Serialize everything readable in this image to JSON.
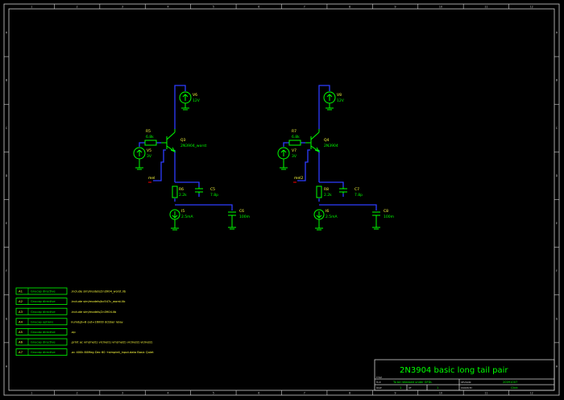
{
  "border": {
    "top_numbers": [
      "1",
      "2",
      "3",
      "4",
      "5",
      "6",
      "7",
      "8",
      "9",
      "10",
      "11",
      "12"
    ],
    "side_letters": [
      "A",
      "B",
      "C",
      "D",
      "E",
      "F",
      "G",
      "H"
    ]
  },
  "circuit_left": {
    "supply": {
      "ref": "V6",
      "value": "12V"
    },
    "bias_resistor": {
      "ref": "R5",
      "value": "6.8k"
    },
    "input_source": {
      "ref": "V5",
      "value": "3V"
    },
    "transistor": {
      "ref": "Q3",
      "value": "2N3904_worst"
    },
    "net_label": "mel",
    "emitter_resistor": {
      "ref": "R6",
      "value": "2.2k"
    },
    "cap_small": {
      "ref": "C5",
      "value": "7.8p"
    },
    "current_source": {
      "ref": "I5",
      "value": "2.5mA"
    },
    "cap_load": {
      "ref": "C6",
      "value": "100m"
    }
  },
  "circuit_right": {
    "supply": {
      "ref": "V8",
      "value": "12V"
    },
    "bias_resistor": {
      "ref": "R7",
      "value": "6.8k"
    },
    "input_source": {
      "ref": "V7",
      "value": "3V"
    },
    "transistor": {
      "ref": "Q4",
      "value": "2N3904"
    },
    "net_label": "mel2",
    "emitter_resistor": {
      "ref": "R8",
      "value": "2.2k"
    },
    "cap_small": {
      "ref": "C7",
      "value": "7.8p"
    },
    "current_source": {
      "ref": "I6",
      "value": "2.5mA"
    },
    "cap_load": {
      "ref": "C8",
      "value": "100m"
    }
  },
  "directives": [
    {
      "id": "A1",
      "type": "Gnucap directive",
      "text": ".include sim/models/2n3904_worst.lib"
    },
    {
      "id": "A2",
      "type": "Gnucap directive",
      "text": ".include sim/models/bc547c_worst.lib"
    },
    {
      "id": "A3",
      "type": "Gnucap directive",
      "text": ".include sim/models/2n3904.lib"
    },
    {
      "id": "A4",
      "type": "Gnucap options",
      "text": "numdgt=8 out=16000 dcbber relay"
    },
    {
      "id": "A5",
      "type": "Gnucap directive",
      "text": ".op"
    },
    {
      "id": "A6",
      "type": "Gnucap directive",
      "text": ".print ac vm(mel1) vr(mel1) vm(mel2) vr(mel2) vi(mel2)"
    },
    {
      "id": "A7",
      "type": "Gnucap directive",
      "text": ".ac 400k 80Meg Dec 60 +simple4_input.data Basic Quiet"
    }
  ],
  "title_block": {
    "title": "2N3904 basic long tail pair",
    "title_label": "TITLE",
    "file_label": "FILE:",
    "file_value": "To be released under GFDL",
    "revision_label": "REVISION:",
    "revision_value": "20091007",
    "page_label": "PAGE",
    "page_value": "1",
    "of_label": "OF",
    "of_value": "1",
    "drawn_by_label": "DRAWN BY:",
    "drawn_by_value": "Click"
  },
  "colors": {
    "background": "#000000",
    "border": "#d0d0d0",
    "component": "#00ff00",
    "wire": "#2d3cff",
    "text": "#ffff40",
    "attribute_text": "#00ff00",
    "pin": "#ff0000"
  }
}
